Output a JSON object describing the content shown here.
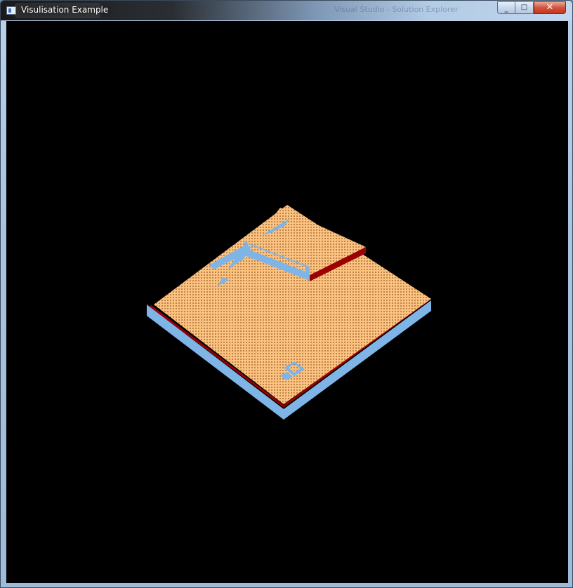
{
  "window": {
    "title": "Visulisation Example",
    "background_window_title": "Visual Studio - Solution Explorer",
    "controls": {
      "minimize": "_",
      "maximize": "□",
      "close": "✕"
    }
  },
  "scene": {
    "background": "#000000",
    "surface_color": "#fdc27f",
    "side_color": "#7fb5e6",
    "edge_color": "#9a0000",
    "dot_color": "#8a5a2a"
  }
}
